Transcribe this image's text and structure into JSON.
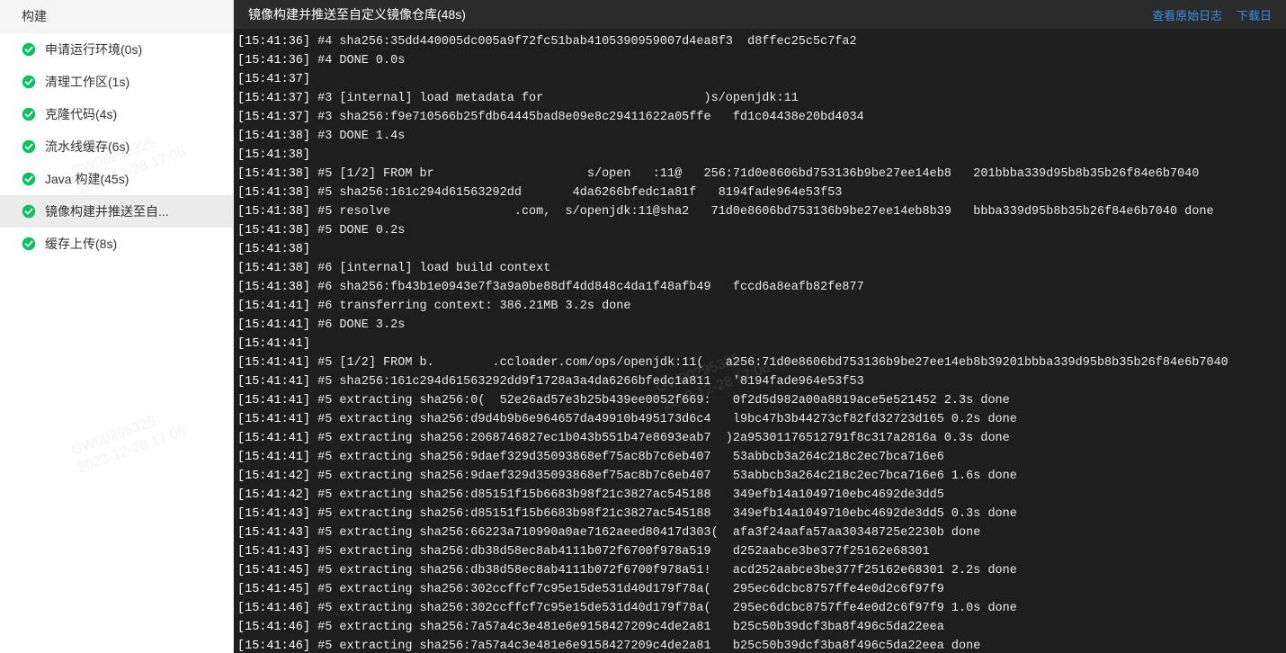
{
  "sidebar": {
    "title": "构建",
    "steps": [
      {
        "label": "申请运行环境(0s)",
        "status": "success",
        "active": false
      },
      {
        "label": "清理工作区(1s)",
        "status": "success",
        "active": false
      },
      {
        "label": "克隆代码(4s)",
        "status": "success",
        "active": false
      },
      {
        "label": "流水线缓存(6s)",
        "status": "success",
        "active": false
      },
      {
        "label": "Java 构建(45s)",
        "status": "success",
        "active": false
      },
      {
        "label": "镜像构建并推送至自...",
        "status": "success",
        "active": true
      },
      {
        "label": "缓存上传(8s)",
        "status": "success",
        "active": false
      }
    ]
  },
  "header": {
    "title": "镜像构建并推送至自定义镜像仓库(48s)",
    "view_raw": "查看原始日志",
    "download": "下载日"
  },
  "watermark": {
    "id": "GW00295325",
    "time": "2023-12-28 17:06"
  },
  "logs": [
    {
      "ts": "[15:41:36]",
      "text": " #4 sha256:35dd440005dc005a9f72fc51bab4105390959007d4ea8f3  d8ffec25c5c7fa2"
    },
    {
      "ts": "[15:41:36]",
      "text": " #4 DONE 0.0s"
    },
    {
      "ts": "[15:41:37]",
      "text": ""
    },
    {
      "ts": "[15:41:37]",
      "text": " #3 [internal] load metadata for                      )s/openjdk:11"
    },
    {
      "ts": "[15:41:37]",
      "text": " #3 sha256:f9e710566b25fdb64445bad8e09e8c29411622a05ffe   fd1c04438e20bd4034"
    },
    {
      "ts": "[15:41:38]",
      "text": " #3 DONE 1.4s"
    },
    {
      "ts": "[15:41:38]",
      "text": ""
    },
    {
      "ts": "[15:41:38]",
      "text": " #5 [1/2] FROM br                     s/open   :11@   256:71d0e8606bd753136b9be27ee14eb8   201bbba339d95b8b35b26f84e6b7040"
    },
    {
      "ts": "[15:41:38]",
      "text": " #5 sha256:161c294d61563292dd       4da6266bfedc1a81f   8194fade964e53f53"
    },
    {
      "ts": "[15:41:38]",
      "text": " #5 resolve                 .com,  s/openjdk:11@sha2   71d0e8606bd753136b9be27ee14eb8b39   bbba339d95b8b35b26f84e6b7040 done"
    },
    {
      "ts": "[15:41:38]",
      "text": " #5 DONE 0.2s"
    },
    {
      "ts": "[15:41:38]",
      "text": ""
    },
    {
      "ts": "[15:41:38]",
      "text": " #6 [internal] load build context"
    },
    {
      "ts": "[15:41:38]",
      "text": " #6 sha256:fb43b1e0943e7f3a9a0be88df4dd848c4da1f48afb49   fccd6a8eafb82fe877"
    },
    {
      "ts": "[15:41:41]",
      "text": " #6 transferring context: 386.21MB 3.2s done"
    },
    {
      "ts": "[15:41:41]",
      "text": " #6 DONE 3.2s"
    },
    {
      "ts": "[15:41:41]",
      "text": ""
    },
    {
      "ts": "[15:41:41]",
      "text": " #5 [1/2] FROM b.        .ccloader.com/ops/openjdk:11(   a256:71d0e8606bd753136b9be27ee14eb8b39201bbba339d95b8b35b26f84e6b7040"
    },
    {
      "ts": "[15:41:41]",
      "text": " #5 sha256:161c294d61563292dd9f1728a3a4da6266bfedc1a811   '8194fade964e53f53"
    },
    {
      "ts": "[15:41:41]",
      "text": " #5 extracting sha256:0(  52e26ad57e3b25b439ee0052f669:   0f2d5d982a00a8819ace5e521452 2.3s done"
    },
    {
      "ts": "[15:41:41]",
      "text": " #5 extracting sha256:d9d4b9b6e964657da49910b495173d6c4   l9bc47b3b44273cf82fd32723d165 0.2s done"
    },
    {
      "ts": "[15:41:41]",
      "text": " #5 extracting sha256:2068746827ec1b043b551b47e8693eab7  )2a95301176512791f8c317a2816a 0.3s done"
    },
    {
      "ts": "[15:41:41]",
      "text": " #5 extracting sha256:9daef329d35093868ef75ac8b7c6eb407   53abbcb3a264c218c2ec7bca716e6"
    },
    {
      "ts": "[15:41:42]",
      "text": " #5 extracting sha256:9daef329d35093868ef75ac8b7c6eb407   53abbcb3a264c218c2ec7bca716e6 1.6s done"
    },
    {
      "ts": "[15:41:42]",
      "text": " #5 extracting sha256:d85151f15b6683b98f21c3827ac545188   349efb14a1049710ebc4692de3dd5"
    },
    {
      "ts": "[15:41:43]",
      "text": " #5 extracting sha256:d85151f15b6683b98f21c3827ac545188   349efb14a1049710ebc4692de3dd5 0.3s done"
    },
    {
      "ts": "[15:41:43]",
      "text": " #5 extracting sha256:66223a710990a0ae7162aeed80417d303(  afa3f24aafa57aa30348725e2230b done"
    },
    {
      "ts": "[15:41:43]",
      "text": " #5 extracting sha256:db38d58ec8ab4111b072f6700f978a519   d252aabce3be377f25162e68301"
    },
    {
      "ts": "[15:41:45]",
      "text": " #5 extracting sha256:db38d58ec8ab4111b072f6700f978a51!   acd252aabce3be377f25162e68301 2.2s done"
    },
    {
      "ts": "[15:41:45]",
      "text": " #5 extracting sha256:302ccffcf7c95e15de531d40d179f78a(   295ec6dcbc8757ffe4e0d2c6f97f9"
    },
    {
      "ts": "[15:41:46]",
      "text": " #5 extracting sha256:302ccffcf7c95e15de531d40d179f78a(   295ec6dcbc8757ffe4e0d2c6f97f9 1.0s done"
    },
    {
      "ts": "[15:41:46]",
      "text": " #5 extracting sha256:7a57a4c3e481e6e9158427209c4de2a81   b25c50b39dcf3ba8f496c5da22eea"
    },
    {
      "ts": "[15:41:46]",
      "text": " #5 extracting sha256:7a57a4c3e481e6e9158427209c4de2a81   b25c50b39dcf3ba8f496c5da22eea done"
    }
  ]
}
